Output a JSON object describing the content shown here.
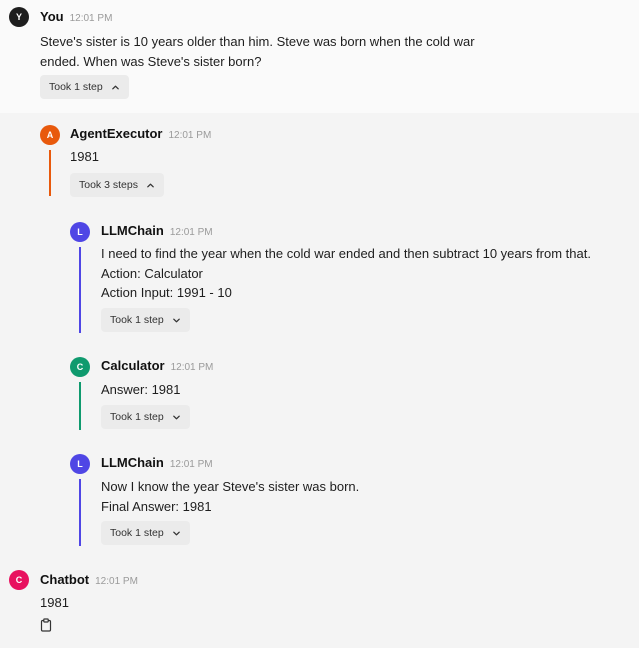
{
  "colors": {
    "you": "#1e1e1e",
    "agent": "#e8590c",
    "llm": "#4f46e5",
    "calculator": "#0f9a6e",
    "chatbot": "#e8115f"
  },
  "user": {
    "avatar": "Y",
    "author": "You",
    "time": "12:01 PM",
    "lines": [
      "Steve's sister is 10 years older than him. Steve was born when the cold war",
      "ended. When was Steve's sister born?"
    ],
    "steps_label": "Took 1 step",
    "steps_icon": "chevron-up-icon"
  },
  "agent": {
    "avatar": "A",
    "author": "AgentExecutor",
    "time": "12:01 PM",
    "text": "1981",
    "steps_label": "Took 3 steps",
    "steps_icon": "chevron-up-icon"
  },
  "llm1": {
    "avatar": "L",
    "author": "LLMChain",
    "time": "12:01 PM",
    "lines": [
      "I need to find the year when the cold war ended and then subtract 10 years from that.",
      "Action: Calculator",
      "Action Input: 1991 - 10"
    ],
    "steps_label": "Took 1 step",
    "steps_icon": "chevron-down-icon"
  },
  "calculator": {
    "avatar": "C",
    "author": "Calculator",
    "time": "12:01 PM",
    "text": "Answer: 1981",
    "steps_label": "Took 1 step",
    "steps_icon": "chevron-down-icon"
  },
  "llm2": {
    "avatar": "L",
    "author": "LLMChain",
    "time": "12:01 PM",
    "lines": [
      "Now I know the year Steve's sister was born.",
      "Final Answer: 1981"
    ],
    "steps_label": "Took 1 step",
    "steps_icon": "chevron-down-icon"
  },
  "chatbot": {
    "avatar": "C",
    "author": "Chatbot",
    "time": "12:01 PM",
    "text": "1981",
    "copy_icon": "clipboard-icon"
  }
}
